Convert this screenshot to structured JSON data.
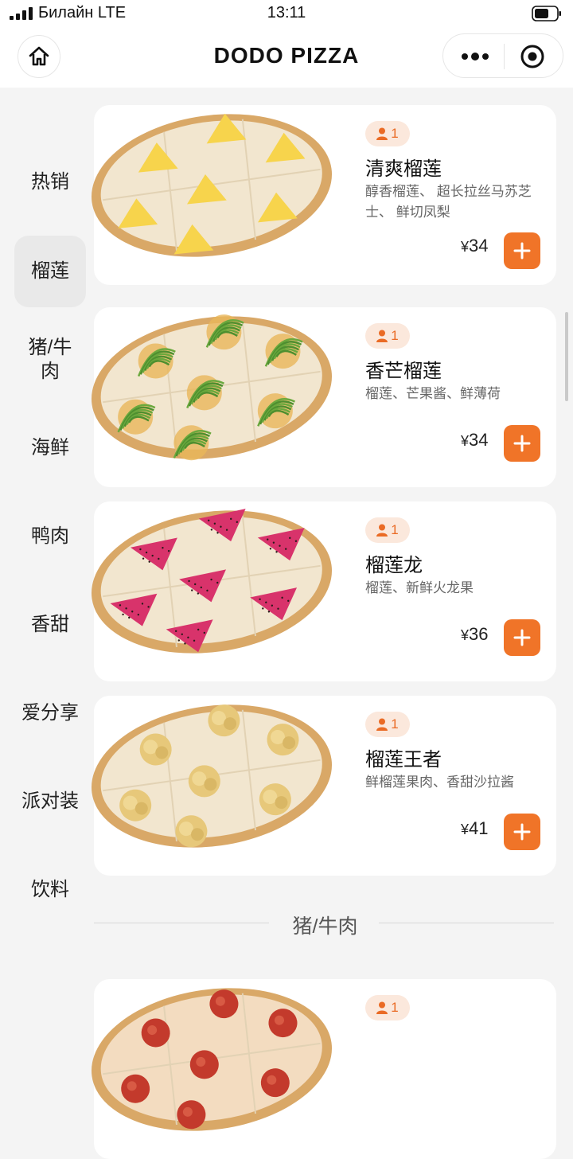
{
  "status_bar": {
    "carrier": "Билайн LTE",
    "time": "13:11"
  },
  "nav": {
    "title": "DODO PIZZA"
  },
  "sidebar": {
    "items": [
      {
        "label": "热销",
        "active": false
      },
      {
        "label": "榴莲",
        "active": true
      },
      {
        "label": "猪/牛肉",
        "active": false
      },
      {
        "label": "海鲜",
        "active": false
      },
      {
        "label": "鸭肉",
        "active": false
      },
      {
        "label": "香甜",
        "active": false
      },
      {
        "label": "爱分享",
        "active": false
      },
      {
        "label": "派对装",
        "active": false
      },
      {
        "label": "饮料",
        "active": false
      }
    ]
  },
  "products": [
    {
      "name": "清爽榴莲",
      "desc": "醇香榴莲、 超长拉丝马苏芝士、 鲜切凤梨",
      "currency": "¥",
      "price": "34",
      "serves": "1",
      "topping": "pineapple"
    },
    {
      "name": "香芒榴莲",
      "desc": "榴莲、芒果酱、鲜薄荷",
      "currency": "¥",
      "price": "34",
      "serves": "1",
      "topping": "mint"
    },
    {
      "name": "榴莲龙",
      "desc": "榴莲、新鲜火龙果",
      "currency": "¥",
      "price": "36",
      "serves": "1",
      "topping": "dragonfruit"
    },
    {
      "name": "榴莲王者",
      "desc": "鲜榴莲果肉、香甜沙拉酱",
      "currency": "¥",
      "price": "41",
      "serves": "1",
      "topping": "durian"
    },
    {
      "name": "",
      "desc": "",
      "currency": "",
      "price": "",
      "serves": "1",
      "topping": "pepperoni"
    }
  ],
  "section_divider": {
    "label": "猪/牛肉"
  },
  "colors": {
    "accent": "#f07428",
    "badge_bg": "#fbe8dc",
    "badge_text": "#ea6b25",
    "active_category_bg": "#e9e9e9"
  },
  "icons": {
    "home": "home-icon",
    "more": "more-dots-icon",
    "close": "target-circle-icon",
    "person": "person-icon",
    "add": "plus-icon"
  }
}
